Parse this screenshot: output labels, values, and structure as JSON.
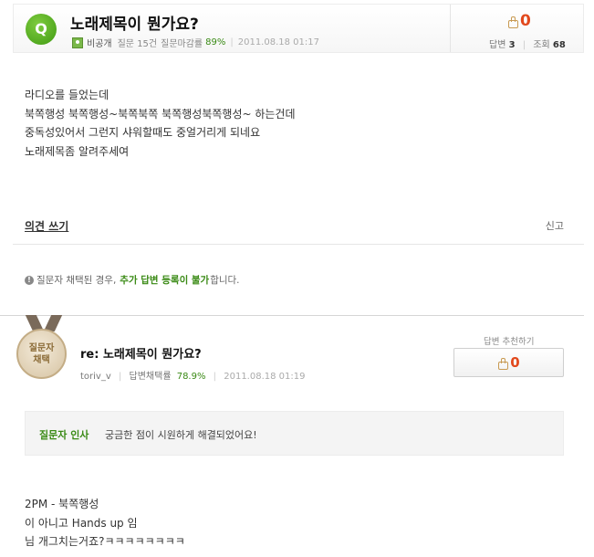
{
  "question": {
    "badge": "Q",
    "title": "노래제목이 뭔가요?",
    "user": "비공개",
    "question_count": "질문 15건",
    "close_rate_label": "질문마감률",
    "close_rate": "89%",
    "date": "2011.08.18 01:17",
    "likes": "0",
    "answer_label": "답변",
    "answer_count": "3",
    "view_label": "조회",
    "view_count": "68",
    "body": [
      "라디오를 들었는데",
      "북쪽행성 북쪽행성~북쪽북쪽 북쪽행성북쪽행성~ 하는건데",
      "중독성있어서 그런지 샤워할때도 중얼거리게 되네요",
      "노래제목좀 알려주세여"
    ]
  },
  "actions": {
    "write_opinion": "의견 쓰기",
    "report": "신고"
  },
  "notice": {
    "prefix": "질문자 채택된 경우,",
    "highlight": "추가 답변 등록이 불가",
    "suffix": "합니다."
  },
  "answer": {
    "medal_line1": "질문자",
    "medal_line2": "채택",
    "title": "re: 노래제목이 뭔가요?",
    "user": "toriv_v",
    "adopt_rate_label": "답변채택률",
    "adopt_rate": "78.9%",
    "date": "2011.08.18 01:19",
    "recommend_label": "답변 추천하기",
    "likes": "0",
    "greeting_label": "질문자 인사",
    "greeting_text": "궁금한 점이 시원하게 해결되었어요!",
    "body": [
      "2PM - 북쪽행성",
      "이 아니고 Hands up 임",
      "님 개그치는거죠?ㅋㅋㅋㅋㅋㅋㅋㅋ"
    ]
  },
  "colors": {
    "accent_green": "#3a8a15",
    "like_orange": "#e2491d"
  }
}
